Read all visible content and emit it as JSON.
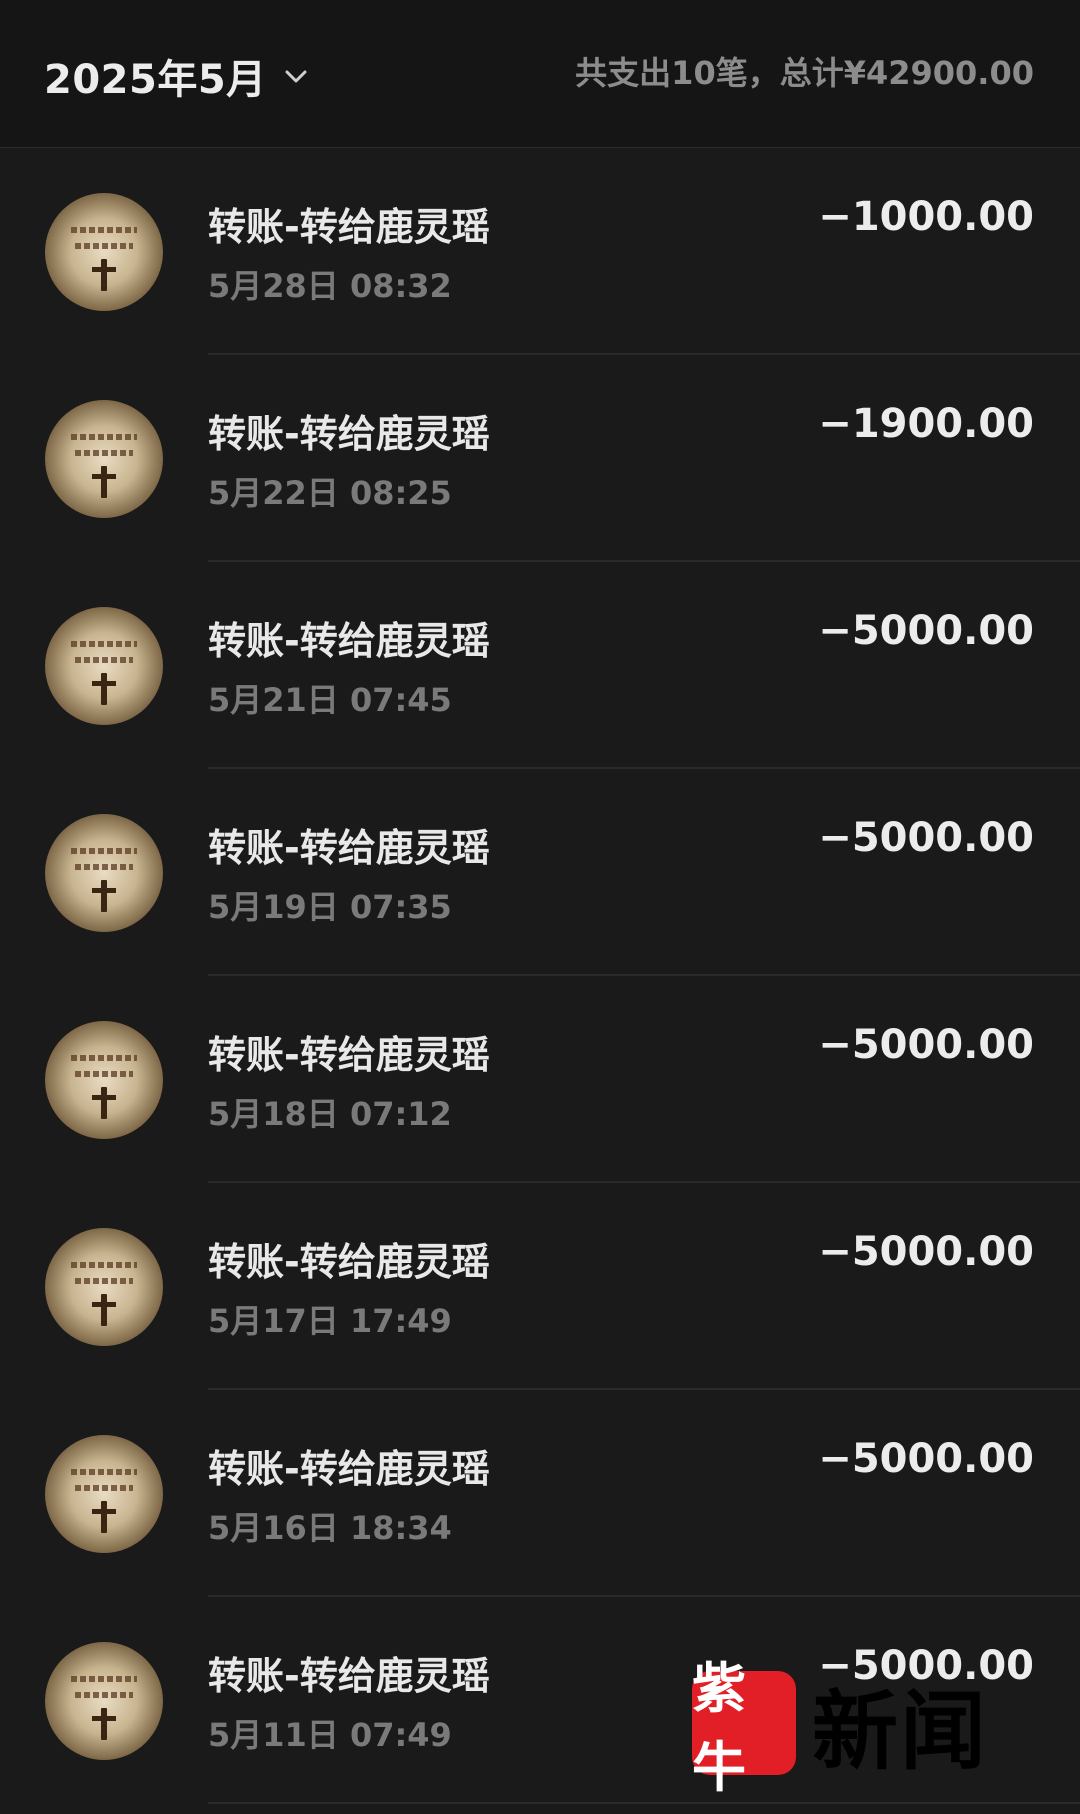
{
  "header": {
    "month": "2025年5月",
    "summary": "共支出10笔，总计¥42900.00"
  },
  "transactions": [
    {
      "title": "转账-转给鹿灵瑶",
      "time": "5月28日 08:32",
      "amount": "−1000.00"
    },
    {
      "title": "转账-转给鹿灵瑶",
      "time": "5月22日 08:25",
      "amount": "−1900.00"
    },
    {
      "title": "转账-转给鹿灵瑶",
      "time": "5月21日 07:45",
      "amount": "−5000.00"
    },
    {
      "title": "转账-转给鹿灵瑶",
      "time": "5月19日 07:35",
      "amount": "−5000.00"
    },
    {
      "title": "转账-转给鹿灵瑶",
      "time": "5月18日 07:12",
      "amount": "−5000.00"
    },
    {
      "title": "转账-转给鹿灵瑶",
      "time": "5月17日 17:49",
      "amount": "−5000.00"
    },
    {
      "title": "转账-转给鹿灵瑶",
      "time": "5月16日 18:34",
      "amount": "−5000.00"
    },
    {
      "title": "转账-转给鹿灵瑶",
      "time": "5月11日 07:49",
      "amount": "−5000.00"
    }
  ],
  "watermark": {
    "logo_text": "紫牛",
    "text": "新闻"
  },
  "colors": {
    "background": "#1a1a1a",
    "header_background": "#151515",
    "watermark_red": "#e21f26"
  },
  "icons": {
    "month_dropdown": "chevron-down-icon"
  }
}
